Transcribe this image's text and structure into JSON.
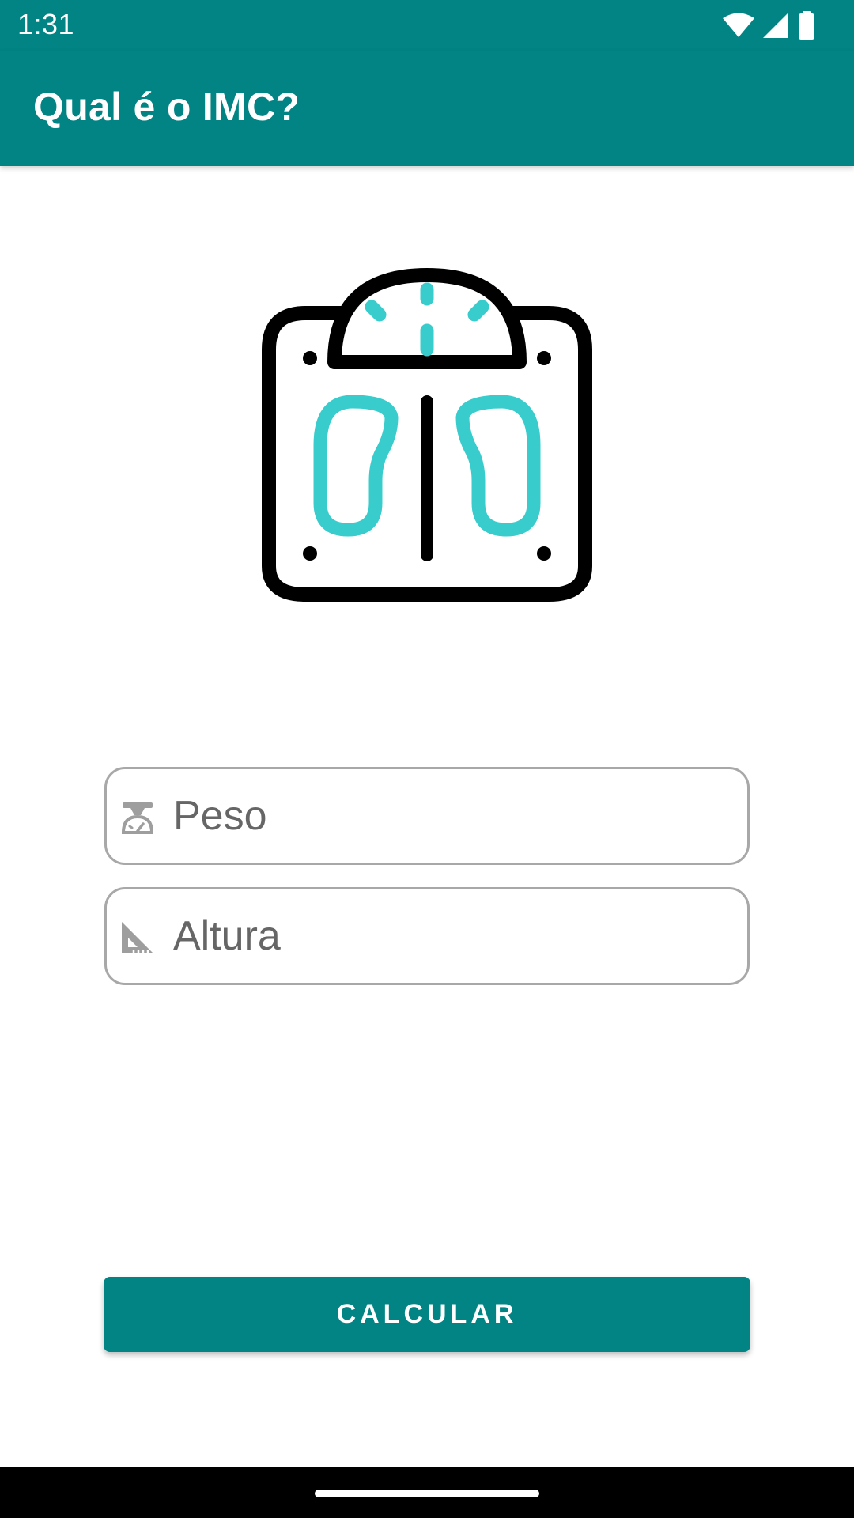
{
  "status_bar": {
    "time": "1:31",
    "icons": [
      "wifi-icon",
      "cell-signal-icon",
      "battery-icon"
    ]
  },
  "app_bar": {
    "title": "Qual é o IMC?"
  },
  "illustration": {
    "icon": "bathroom-scale-icon",
    "colors": {
      "outline": "#000000",
      "accent": "#38cccc"
    }
  },
  "form": {
    "peso": {
      "placeholder": "Peso",
      "value": "",
      "icon": "weight-scale-icon"
    },
    "altura": {
      "placeholder": "Altura",
      "value": "",
      "icon": "set-square-icon"
    }
  },
  "button": {
    "label": "CALCULAR"
  },
  "theme": {
    "primary": "#028484",
    "accent": "#38cccc",
    "field_border": "#a8a8a8"
  }
}
